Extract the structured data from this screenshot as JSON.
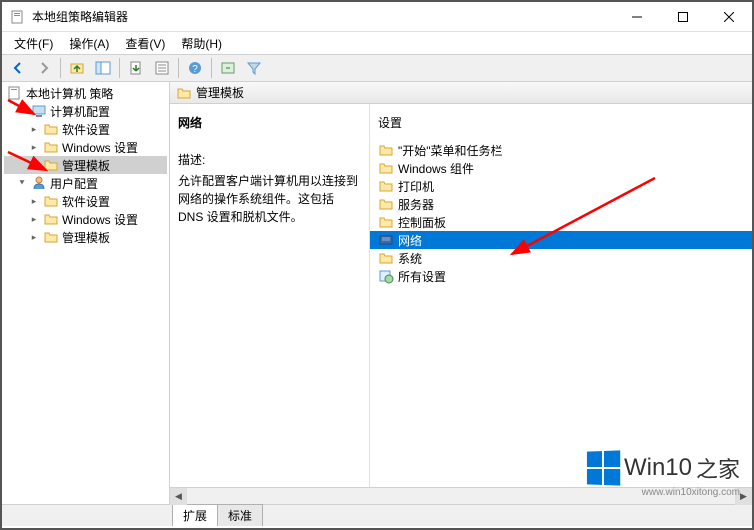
{
  "window": {
    "title": "本地组策略编辑器"
  },
  "menu": {
    "file": "文件(F)",
    "action": "操作(A)",
    "view": "查看(V)",
    "help": "帮助(H)"
  },
  "tree": {
    "root": "本地计算机 策略",
    "computer_config": "计算机配置",
    "software_settings": "软件设置",
    "windows_settings": "Windows 设置",
    "admin_templates": "管理模板",
    "user_config": "用户配置"
  },
  "header": {
    "title": "管理模板"
  },
  "description": {
    "title": "网络",
    "label": "描述:",
    "text": "允许配置客户端计算机用以连接到网络的操作系统组件。这包括 DNS 设置和脱机文件。"
  },
  "settings": {
    "header": "设置",
    "items": [
      "\"开始\"菜单和任务栏",
      "Windows 组件",
      "打印机",
      "服务器",
      "控制面板",
      "网络",
      "系统",
      "所有设置"
    ],
    "selected_index": 5
  },
  "tabs": {
    "extended": "扩展",
    "standard": "标准"
  },
  "watermark": {
    "brand": "Win10",
    "suffix": "之家",
    "url": "www.win10xitong.com"
  }
}
